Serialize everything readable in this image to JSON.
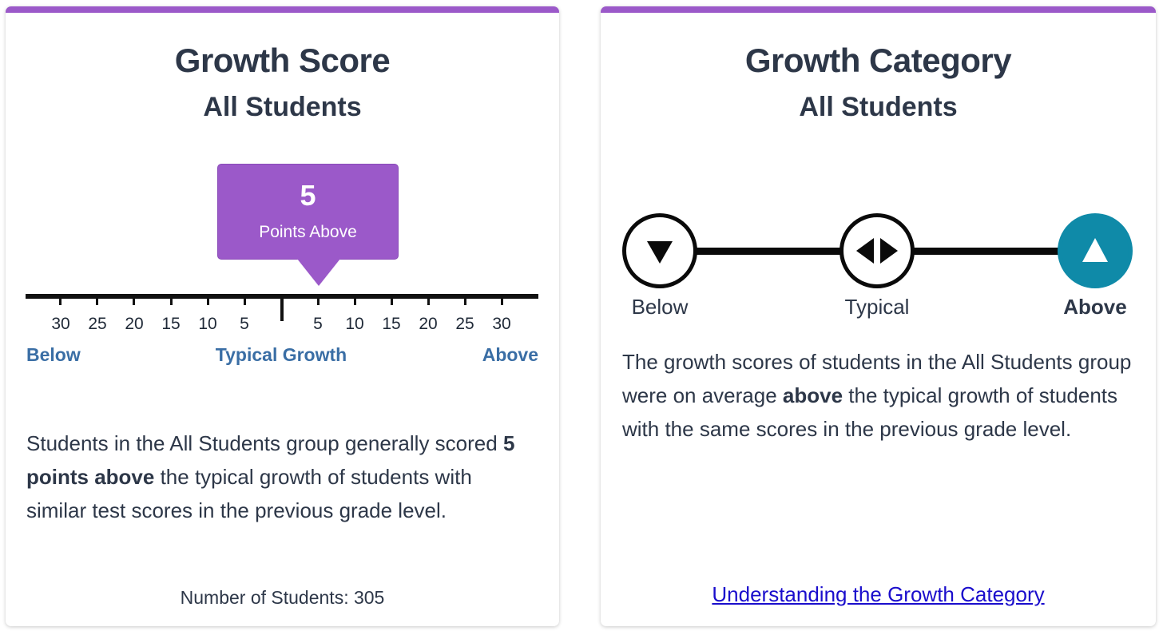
{
  "score_card": {
    "title": "Growth Score",
    "subtitle": "All Students",
    "callout_value": "5",
    "callout_label": "Points Above",
    "tick_labels_left": [
      "30",
      "25",
      "20",
      "15",
      "10",
      "5"
    ],
    "tick_labels_right": [
      "5",
      "10",
      "15",
      "20",
      "25",
      "30"
    ],
    "scale_below": "Below",
    "scale_typical": "Typical Growth",
    "scale_above": "Above",
    "desc_before": "Students in the All Students group generally scored ",
    "desc_bold": "5 points above",
    "desc_after": " the typical growth of students with similar test scores in the previous grade level.",
    "count": "Number of Students: 305",
    "colors": {
      "accent": "#9b59c9",
      "scale_text": "#3a6ea5"
    }
  },
  "category_card": {
    "title": "Growth Category",
    "subtitle": "All Students",
    "levels": [
      {
        "label": "Below",
        "icon": "triangle-down-icon",
        "active": false
      },
      {
        "label": "Typical",
        "icon": "left-right-arrows-icon",
        "active": false
      },
      {
        "label": "Above",
        "icon": "triangle-up-icon",
        "active": true
      }
    ],
    "desc_before": "The growth scores of students in the All Students group were on average ",
    "desc_bold": "above",
    "desc_after": " the typical growth of students with the same scores in the previous grade level.",
    "link": "Understanding the Growth Category",
    "colors": {
      "active": "#0f8aa8",
      "link": "#1a0dcc"
    }
  }
}
